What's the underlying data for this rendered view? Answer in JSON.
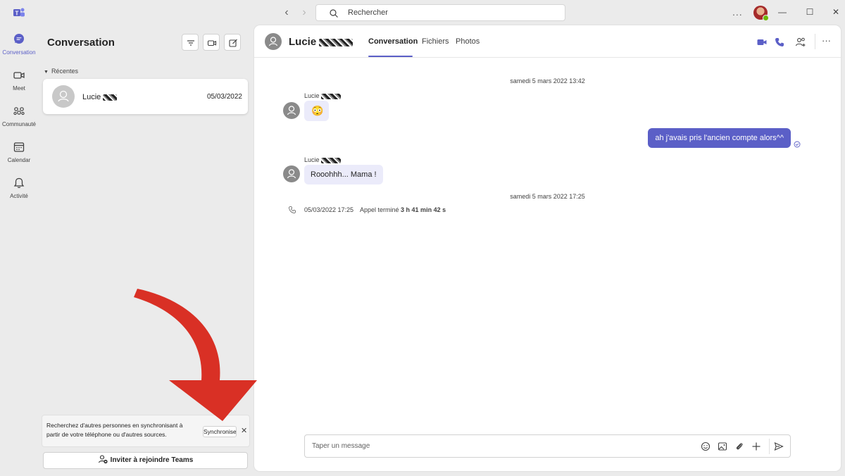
{
  "titlebar": {
    "search_placeholder": "Rechercher",
    "more_label": "...",
    "minimize_label": "—",
    "maximize_label": "☐",
    "close_label": "✕"
  },
  "rail": {
    "items": [
      {
        "label": "Conversation",
        "icon": "chat-icon",
        "active": true
      },
      {
        "label": "Meet",
        "icon": "video-icon",
        "active": false
      },
      {
        "label": "Communauté",
        "icon": "community-icon",
        "active": false
      },
      {
        "label": "Calendar",
        "icon": "calendar-icon",
        "active": false
      },
      {
        "label": "Activité",
        "icon": "bell-icon",
        "active": false
      }
    ]
  },
  "list": {
    "title": "Conversation",
    "section_label": "Récentes",
    "chats": [
      {
        "name": "Lucie",
        "date": "05/03/2022"
      }
    ],
    "sync": {
      "text": "Recherchez d'autres personnes en synchronisant à partir de votre téléphone ou d'autres sources.",
      "button_label": "Synchroniser",
      "close_label": "✕"
    },
    "invite_label": "Inviter à rejoindre Teams"
  },
  "chat": {
    "contact_name": "Lucie",
    "tabs": [
      "Conversation",
      "Fichiers",
      "Photos"
    ],
    "active_tab": "Conversation",
    "more_label": "···",
    "messages": {
      "ts1": "samedi 5 mars 2022 13:42",
      "sender1": "Lucie",
      "emoji1": "😳",
      "out1": "ah j'avais pris l'ancien compte alors^^",
      "sender2": "Lucie",
      "in2": "Rooohhh... Mama !",
      "ts2": "samedi 5 mars 2022 17:25",
      "call_date": "05/03/2022 17:25",
      "call_text": "Appel terminé",
      "call_duration": "3 h 41 min 42 s"
    },
    "composer_placeholder": "Taper un message"
  },
  "colors": {
    "accent": "#5b5fc7",
    "annotation_arrow": "#d93025"
  }
}
